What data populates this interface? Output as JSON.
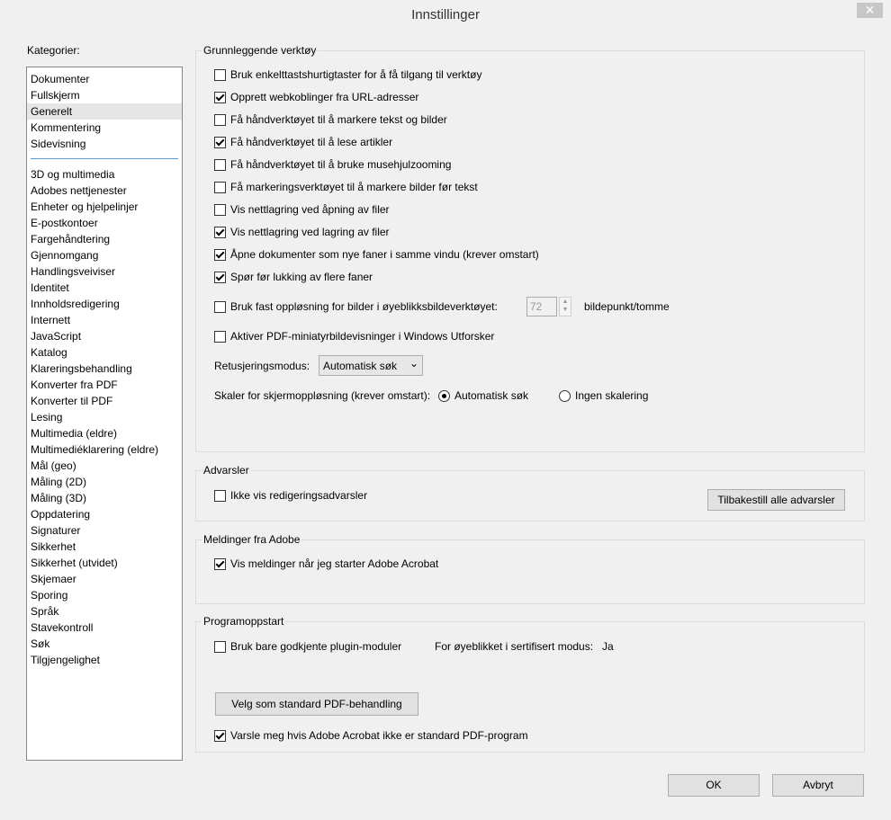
{
  "dialog": {
    "title": "Innstillinger",
    "close": "✕",
    "ok": "OK",
    "cancel": "Avbryt"
  },
  "categories": {
    "label": "Kategorier:",
    "selected": "Generelt",
    "items": [
      "Dokumenter",
      "Fullskjerm",
      "Generelt",
      "Kommentering",
      "Sidevisning",
      "3D og multimedia",
      "Adobes nettjenester",
      "Enheter og hjelpelinjer",
      "E-postkontoer",
      "Fargehåndtering",
      "Gjennomgang",
      "Handlingsveiviser",
      "Identitet",
      "Innholdsredigering",
      "Internett",
      "JavaScript",
      "Katalog",
      "Klareringsbehandling",
      "Konverter fra PDF",
      "Konverter til PDF",
      "Lesing",
      "Multimedia (eldre)",
      "Multimediéklarering (eldre)",
      "Mål (geo)",
      "Måling (2D)",
      "Måling (3D)",
      "Oppdatering",
      "Signaturer",
      "Sikkerhet",
      "Sikkerhet (utvidet)",
      "Skjemaer",
      "Sporing",
      "Språk",
      "Stavekontroll",
      "Søk",
      "Tilgjengelighet"
    ]
  },
  "basic_tools": {
    "title": "Grunnleggende verktøy",
    "options": [
      {
        "label": "Bruk enkelttastshurtigtaster for å få tilgang til verktøy",
        "checked": false
      },
      {
        "label": "Opprett webkoblinger fra URL-adresser",
        "checked": true
      },
      {
        "label": "Få håndverktøyet til å markere tekst og bilder",
        "checked": false
      },
      {
        "label": "Få håndverktøyet til å lese artikler",
        "checked": true
      },
      {
        "label": "Få håndverktøyet til å bruke musehjulzooming",
        "checked": false
      },
      {
        "label": "Få markeringsverktøyet til å markere bilder før tekst",
        "checked": false
      },
      {
        "label": "Vis nettlagring ved åpning av filer",
        "checked": false
      },
      {
        "label": "Vis nettlagring ved lagring av filer",
        "checked": true
      },
      {
        "label": "Åpne dokumenter som nye faner i samme vindu (krever omstart)",
        "checked": true
      },
      {
        "label": "Spør før lukking av flere faner",
        "checked": true
      }
    ],
    "fixed_resolution": {
      "label": "Bruk fast oppløsning for bilder i øyeblikksbildeverktøyet:",
      "checked": false,
      "value": "72",
      "unit": "bildepunkt/tomme"
    },
    "thumbnail": {
      "label": "Aktiver PDF-miniatyrbildevisninger i Windows Utforsker",
      "checked": false
    },
    "touch_mode": {
      "label": "Retusjeringsmodus:",
      "value": "Automatisk søk"
    },
    "scaling": {
      "label": "Skaler for skjermoppløsning (krever omstart):",
      "auto": "Automatisk søk",
      "none": "Ingen skalering",
      "selected": "auto"
    }
  },
  "warnings": {
    "title": "Advarsler",
    "hide_label": "Ikke vis redigeringsadvarsler",
    "hide_checked": false,
    "reset_button": "Tilbakestill alle advarsler"
  },
  "messages": {
    "title": "Meldinger fra Adobe",
    "show_label": "Vis meldinger når jeg starter Adobe Acrobat",
    "show_checked": true
  },
  "startup": {
    "title": "Programoppstart",
    "plugins_label": "Bruk bare godkjente plugin-moduler",
    "plugins_checked": false,
    "certified_label": "For øyeblikket i sertifisert modus:",
    "certified_value": "Ja",
    "default_button": "Velg som standard PDF-behandling",
    "warn_label": "Varsle meg hvis Adobe Acrobat ikke er standard PDF-program",
    "warn_checked": true
  }
}
